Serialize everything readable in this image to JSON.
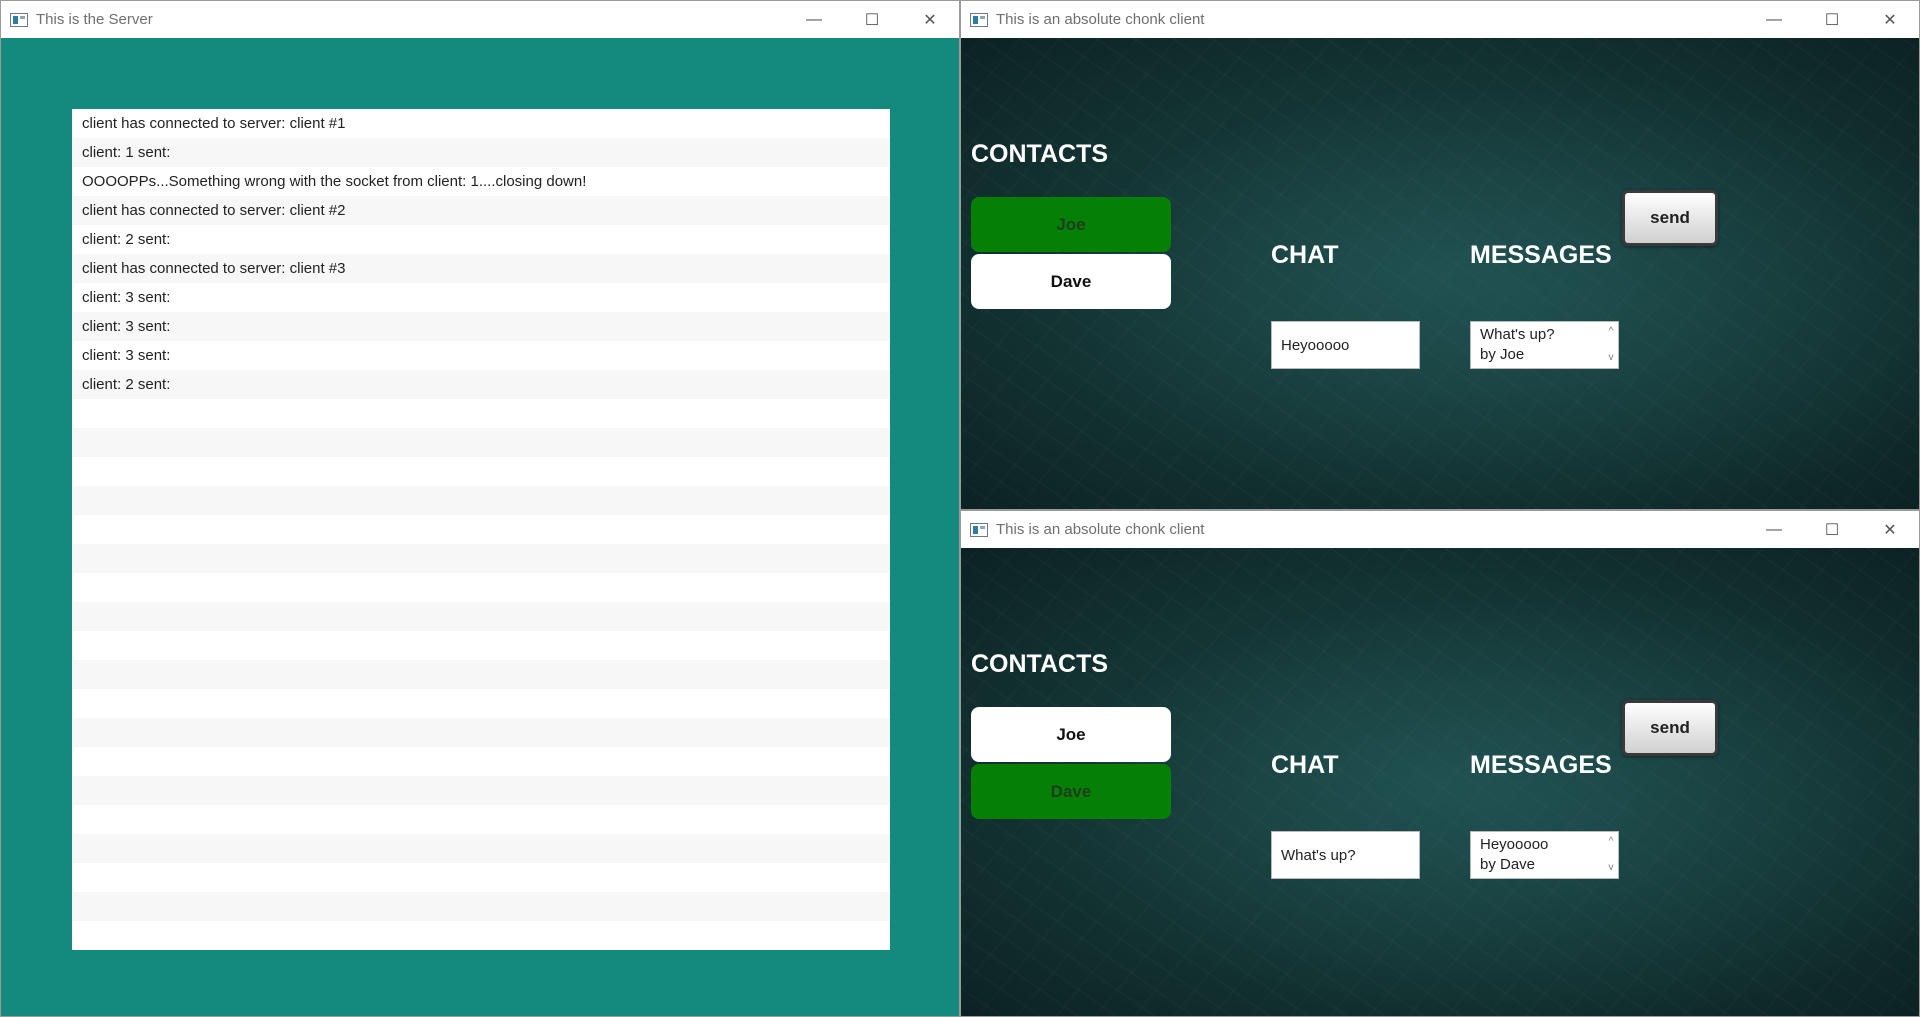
{
  "server": {
    "title": "This is the Server",
    "log": [
      "client has connected to server: client #1",
      "client: 1 sent:",
      "OOOOPPs...Something wrong with the socket from client: 1....closing down!",
      "client has connected to server: client #2",
      "client: 2 sent:",
      "client has connected to server: client #3",
      "client: 3 sent:",
      "client: 3 sent:",
      "client: 3 sent:",
      "client: 2 sent:",
      "",
      "",
      "",
      "",
      "",
      "",
      "",
      "",
      "",
      "",
      "",
      "",
      "",
      "",
      "",
      "",
      "",
      "",
      "",
      ""
    ]
  },
  "window_controls": {
    "minimize": "—",
    "maximize": "☐",
    "close": "✕"
  },
  "clients": [
    {
      "title": "This is an absolute chonk client",
      "contacts_heading": "CONTACTS",
      "contacts": [
        {
          "name": "Joe",
          "selected": true
        },
        {
          "name": "Dave",
          "selected": false
        }
      ],
      "chat_heading": "CHAT",
      "messages_heading": "MESSAGES",
      "chat_value": "Heyooooo",
      "messages": [
        "What's up?",
        "by Joe"
      ],
      "send_label": "send"
    },
    {
      "title": "This is an absolute chonk client",
      "contacts_heading": "CONTACTS",
      "contacts": [
        {
          "name": "Joe",
          "selected": false
        },
        {
          "name": "Dave",
          "selected": true
        }
      ],
      "chat_heading": "CHAT",
      "messages_heading": "MESSAGES",
      "chat_value": "What's up?",
      "messages": [
        "Heyooooo",
        "by Dave"
      ],
      "send_label": "send"
    }
  ],
  "colors": {
    "server_bg": "#138a7d",
    "selected_contact": "#058005",
    "client_bg": "#163838"
  },
  "icons": {
    "scroll_up": "^",
    "scroll_down": "v"
  }
}
